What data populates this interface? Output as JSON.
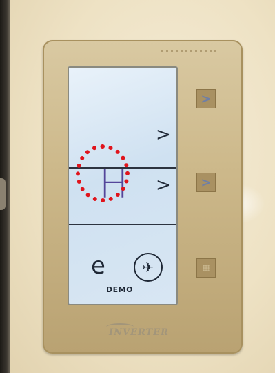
{
  "display": {
    "mode_value": "H",
    "row1_arrow": ">",
    "row2_arrow": ">",
    "eco_symbol": "e",
    "fan_symbol": "✈",
    "demo_label": "DEMO"
  },
  "side_buttons": [
    {
      "glyph": ">",
      "icon": "chevron-right-icon"
    },
    {
      "glyph": ">",
      "icon": "chevron-right-icon"
    },
    {
      "glyph": "",
      "icon": "grid-icon"
    }
  ],
  "brand_text": "INVERTER",
  "colors": {
    "panel": "#cdb98b",
    "screen": "#d8e6f3",
    "mode_value": "#54469a",
    "highlight": "#e0141c"
  }
}
